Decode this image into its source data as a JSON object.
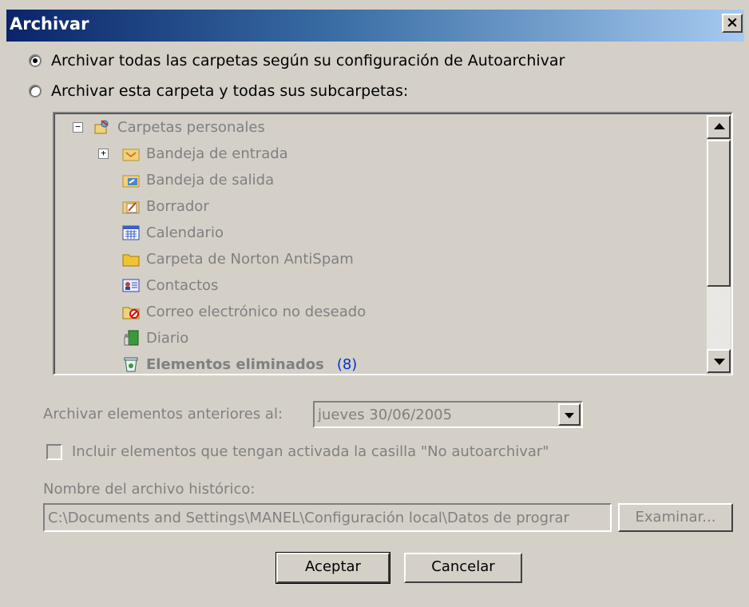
{
  "window": {
    "title": "Archivar",
    "close_label": "×"
  },
  "options": {
    "archive_all_label": "Archivar todas las carpetas según su configuración de Autoarchivar",
    "archive_folder_label": "Archivar esta carpeta y todas sus subcarpetas:",
    "selected": "archive_all"
  },
  "tree": {
    "items": [
      {
        "label": "Carpetas personales",
        "icon": "personal-folders-icon",
        "bold": false,
        "count": ""
      },
      {
        "label": "Bandeja de entrada",
        "icon": "inbox-icon",
        "bold": false,
        "count": ""
      },
      {
        "label": "Bandeja de salida",
        "icon": "outbox-icon",
        "bold": false,
        "count": ""
      },
      {
        "label": "Borrador",
        "icon": "drafts-icon",
        "bold": false,
        "count": ""
      },
      {
        "label": "Calendario",
        "icon": "calendar-icon",
        "bold": false,
        "count": ""
      },
      {
        "label": "Carpeta de Norton AntiSpam",
        "icon": "folder-icon",
        "bold": false,
        "count": ""
      },
      {
        "label": "Contactos",
        "icon": "contacts-icon",
        "bold": false,
        "count": ""
      },
      {
        "label": "Correo electrónico no deseado",
        "icon": "junk-mail-icon",
        "bold": false,
        "count": ""
      },
      {
        "label": "Diario",
        "icon": "journal-icon",
        "bold": false,
        "count": ""
      },
      {
        "label": "Elementos eliminados",
        "icon": "deleted-items-icon",
        "bold": true,
        "count": "(8)"
      }
    ]
  },
  "date_filter": {
    "label": "Archivar elementos anteriores al:",
    "value": "jueves 30/06/2005"
  },
  "include_checkbox": {
    "label": "Incluir elementos que tengan activada la casilla \"No autoarchivar\"",
    "checked": false
  },
  "archive_file": {
    "label": "Nombre del archivo histórico:",
    "value": "C:\\Documents and Settings\\MANEL\\Configuración local\\Datos de prograr",
    "browse_label": "Examinar..."
  },
  "buttons": {
    "ok_label": "Aceptar",
    "cancel_label": "Cancelar"
  },
  "colors": {
    "dialog_bg": "#d4d0c8",
    "title_start": "#0a246a",
    "title_end": "#a6caf0",
    "disabled_text": "#808080",
    "count_color": "#0033cc"
  }
}
